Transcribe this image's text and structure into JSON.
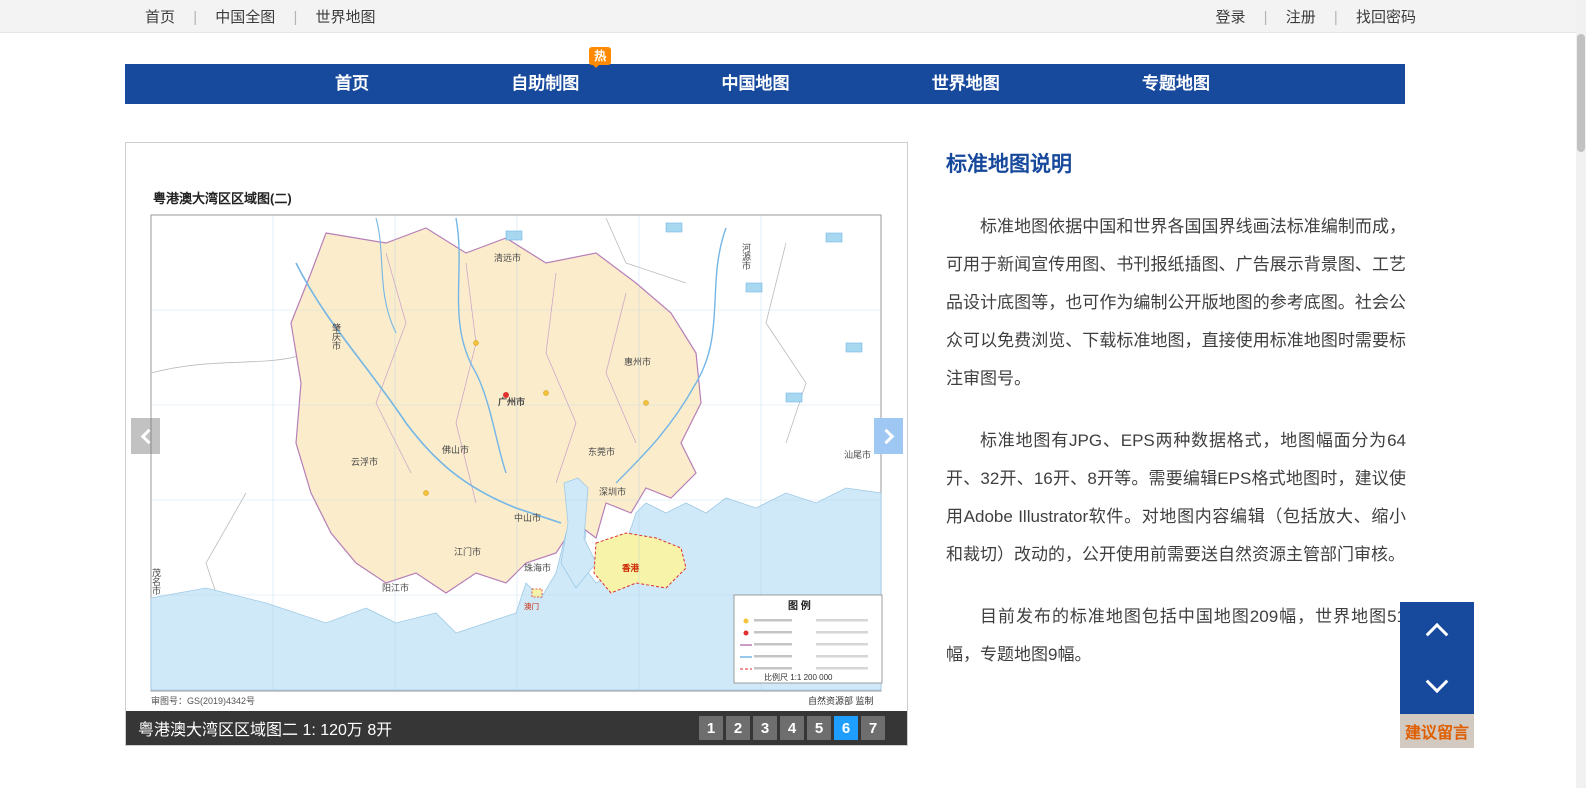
{
  "topbar": {
    "separator": "|",
    "links_left": [
      "首页",
      "中国全图",
      "世界地图"
    ],
    "links_right": [
      "登录",
      "注册",
      "找回密码"
    ]
  },
  "nav": {
    "items": [
      "首页",
      "自助制图",
      "中国地图",
      "世界地图",
      "专题地图"
    ],
    "hot_badge": "热"
  },
  "viewer": {
    "map": {
      "title": "粤港澳大湾区区域图(二)",
      "approval_no": "审图号：GS(2019)4342号",
      "producer": "自然资源部 监制",
      "legend_title": "图 例",
      "scale": "比例尺 1:1 200 000",
      "labels": [
        {
          "text": "清远市"
        },
        {
          "text": "河源市"
        },
        {
          "text": "肇庆市"
        },
        {
          "text": "惠州市"
        },
        {
          "text": "广州市"
        },
        {
          "text": "佛山市"
        },
        {
          "text": "东莞市"
        },
        {
          "text": "汕尾市"
        },
        {
          "text": "云浮市"
        },
        {
          "text": "深圳市"
        },
        {
          "text": "中山市"
        },
        {
          "text": "江门市"
        },
        {
          "text": "珠海市"
        },
        {
          "text": "香港"
        },
        {
          "text": "澳门"
        },
        {
          "text": "阳江市"
        },
        {
          "text": "茂名市"
        }
      ]
    },
    "caption": "粤港澳大湾区区域图二 1: 120万 8开",
    "pages": [
      "1",
      "2",
      "3",
      "4",
      "5",
      "6",
      "7"
    ],
    "active_page": "6"
  },
  "article": {
    "title": "标准地图说明",
    "paragraphs": [
      "标准地图依据中国和世界各国国界线画法标准编制而成，可用于新闻宣传用图、书刊报纸插图、广告展示背景图、工艺品设计底图等，也可作为编制公开版地图的参考底图。社会公众可以免费浏览、下载标准地图，直接使用标准地图时需要标注审图号。",
      "标准地图有JPG、EPS两种数据格式，地图幅面分为64开、32开、16开、8开等。需要编辑EPS格式地图时，建议使用Adobe Illustrator软件。对地图内容编辑（包括放大、缩小和裁切）改动的，公开使用前需要送自然资源主管部门审核。",
      "目前发布的标准地图包括中国地图209幅，世界地图51幅，专题地图9幅。"
    ]
  },
  "floating": {
    "suggest": "建议留言"
  },
  "colors": {
    "nav_blue": "#17499d",
    "hot_orange": "#ff8a00",
    "active_page_blue": "#1e9fff",
    "heading_blue": "#16489b",
    "suggest_orange": "#e05e00"
  }
}
